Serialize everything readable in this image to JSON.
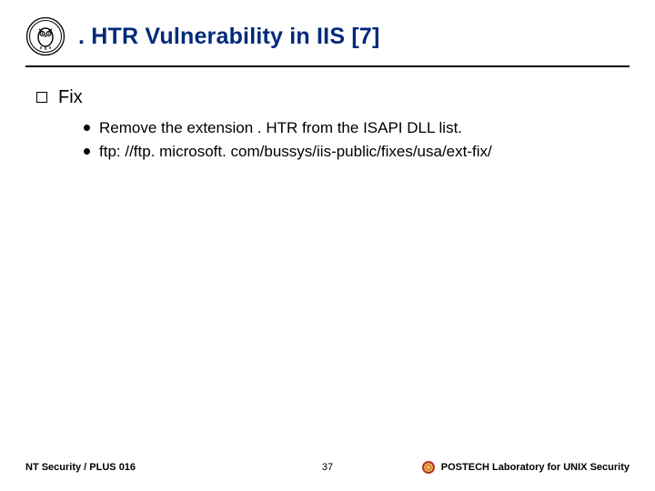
{
  "header": {
    "title": ". HTR Vulnerability in IIS [7]"
  },
  "section": {
    "label": "Fix",
    "items": [
      "Remove the extension . HTR from the ISAPI DLL list.",
      "ftp: //ftp. microsoft. com/bussys/iis-public/fixes/usa/ext-fix/"
    ]
  },
  "footer": {
    "left": "NT Security / PLUS 016",
    "center": "37",
    "right": "POSTECH Laboratory for UNIX Security"
  }
}
